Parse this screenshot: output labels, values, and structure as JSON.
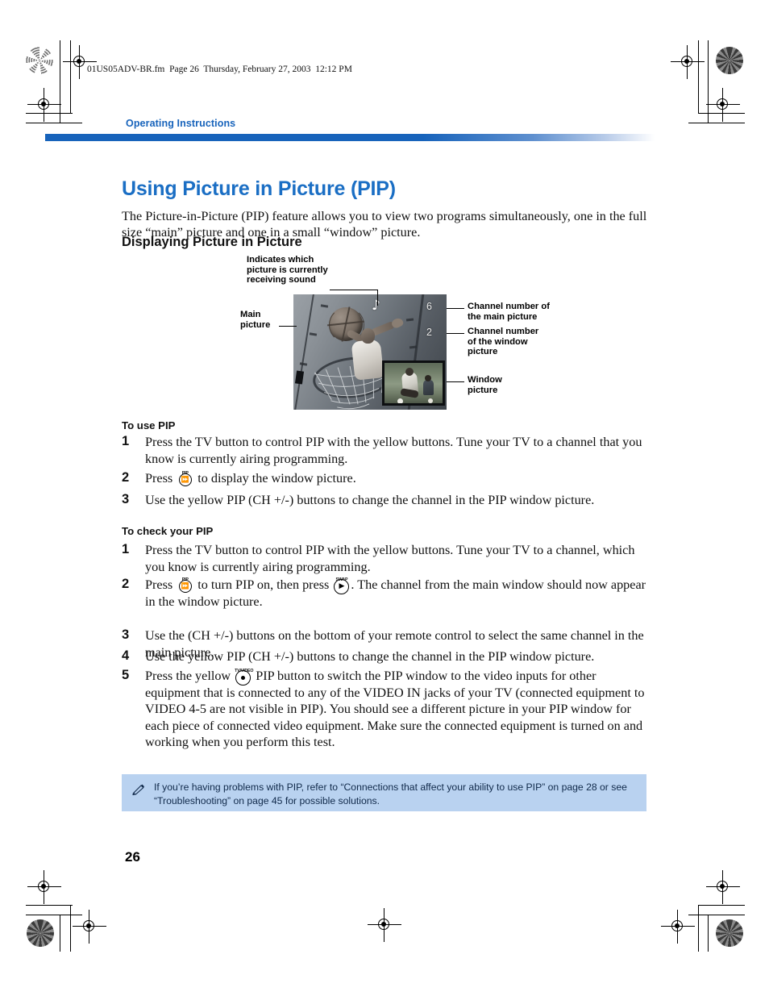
{
  "fm_header": "01US05ADV-BR.fm  Page 26  Thursday, February 27, 2003  12:12 PM",
  "running_head": "Operating Instructions",
  "page_title": "Using Picture in Picture (PIP)",
  "intro": "The Picture-in-Picture (PIP) feature allows you to view two programs simultaneously, one in the full size “main” picture and one in a small “window” picture.",
  "sub_head_display": "Displaying Picture in Picture",
  "figure": {
    "callout_sound": "Indicates which\npicture is currently\nreceiving sound",
    "callout_main": "Main\npicture",
    "callout_channel_main": "Channel number of\nthe main picture",
    "callout_channel_window": "Channel number\nof the window\npicture",
    "callout_window": "Window\npicture",
    "osd_note_glyph": "♪",
    "osd_channel_main": "6",
    "osd_channel_window": "2"
  },
  "sections": [
    {
      "heading": "To use PIP",
      "steps": [
        {
          "num": "1",
          "parts": [
            {
              "type": "text",
              "value": "Press the TV button to control PIP with the yellow buttons. Tune your TV to a channel that you know is currently airing programming."
            }
          ]
        },
        {
          "num": "2",
          "parts": [
            {
              "type": "text",
              "value": "Press "
            },
            {
              "type": "key",
              "cap": "PIP",
              "glyph": "⏩",
              "style": "small"
            },
            {
              "type": "text",
              "value": " to display the window picture."
            }
          ]
        },
        {
          "num": "3",
          "parts": [
            {
              "type": "text",
              "value": "Use the yellow PIP (CH +/-) buttons to change the channel in the PIP window picture."
            }
          ]
        }
      ]
    },
    {
      "heading": "To check your PIP",
      "steps": [
        {
          "num": "1",
          "parts": [
            {
              "type": "text",
              "value": "Press the TV button to control PIP with the yellow buttons. Tune your TV to a channel, which you know is currently airing programming."
            }
          ]
        },
        {
          "num": "2",
          "parts": [
            {
              "type": "text",
              "value": "Press "
            },
            {
              "type": "key",
              "cap": "PIP",
              "glyph": "⏩",
              "style": "small"
            },
            {
              "type": "text",
              "value": " to turn PIP on, then press "
            },
            {
              "type": "key",
              "cap": "SWAP",
              "glyph": "▶",
              "style": "big"
            },
            {
              "type": "text",
              "value": ". The channel from the main window should now appear in the window picture."
            }
          ]
        },
        {
          "num": "3",
          "parts": [
            {
              "type": "text",
              "value": "Use the (CH +/-) buttons on the bottom of your remote control to select the same channel in the main picture."
            }
          ]
        },
        {
          "num": "4",
          "parts": [
            {
              "type": "text",
              "value": "Use the yellow PIP (CH +/-) buttons to change the channel in the PIP window picture."
            }
          ]
        },
        {
          "num": "5",
          "parts": [
            {
              "type": "text",
              "value": "Press the yellow  "
            },
            {
              "type": "key",
              "cap": "TV/VIDEO",
              "glyph": "dot",
              "style": "big"
            },
            {
              "type": "text",
              "value": "  PIP button to switch the PIP window to the video inputs for other equipment that is connected to any of the VIDEO IN jacks of your TV (connected equipment to VIDEO 4-5 are not visible in PIP). You should see a different picture in your PIP window for each piece of connected video equipment. Make sure the connected equipment is turned on and working when you perform this test."
            }
          ]
        }
      ]
    }
  ],
  "note": "If you’re having problems with PIP, refer to “Connections that affect your ability to use PIP” on page 28 or see “Troubleshooting” on page 45 for possible solutions.",
  "folio": "26",
  "colors": {
    "accent_blue": "#1a6ec4",
    "rule_blue": "#1763bb",
    "note_bg": "#b9d2f0"
  }
}
